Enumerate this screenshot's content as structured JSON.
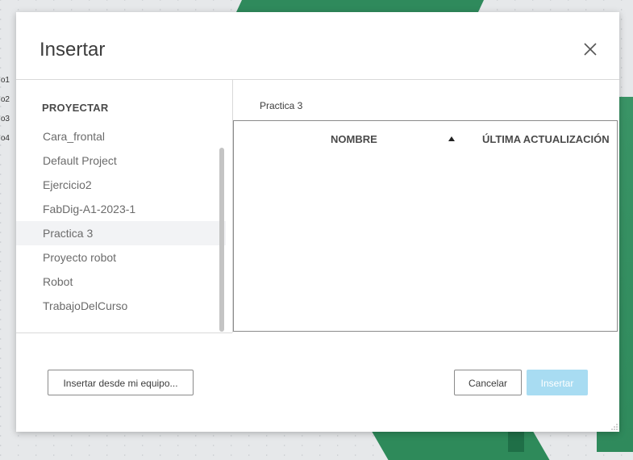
{
  "dialog": {
    "title": "Insertar",
    "close_icon": "close-icon"
  },
  "sidebar": {
    "heading": "PROYECTAR",
    "projects": [
      {
        "label": "Cara_frontal"
      },
      {
        "label": "Default Project"
      },
      {
        "label": "Ejercicio2"
      },
      {
        "label": "FabDig-A1-2023-1"
      },
      {
        "label": "Practica 3",
        "selected": true
      },
      {
        "label": "Proyecto robot"
      },
      {
        "label": "Robot"
      },
      {
        "label": "TrabajoDelCurso"
      }
    ]
  },
  "main": {
    "breadcrumb": "Practica 3",
    "columns": {
      "name": "NOMBRE",
      "sort_icon": "sort-ascending-icon",
      "updated": "ÚLTIMA ACTUALIZACIÓN"
    }
  },
  "footer": {
    "upload_label": "Insertar desde mi equipo...",
    "cancel_label": "Cancelar",
    "insert_label": "Insertar"
  },
  "background": {
    "side_labels": [
      "o1",
      "o2",
      "o3",
      "o4"
    ]
  },
  "colors": {
    "accent_disabled": "#a8dcf2",
    "selected_row": "#f2f3f5",
    "model_green": "#2f8a5c"
  }
}
